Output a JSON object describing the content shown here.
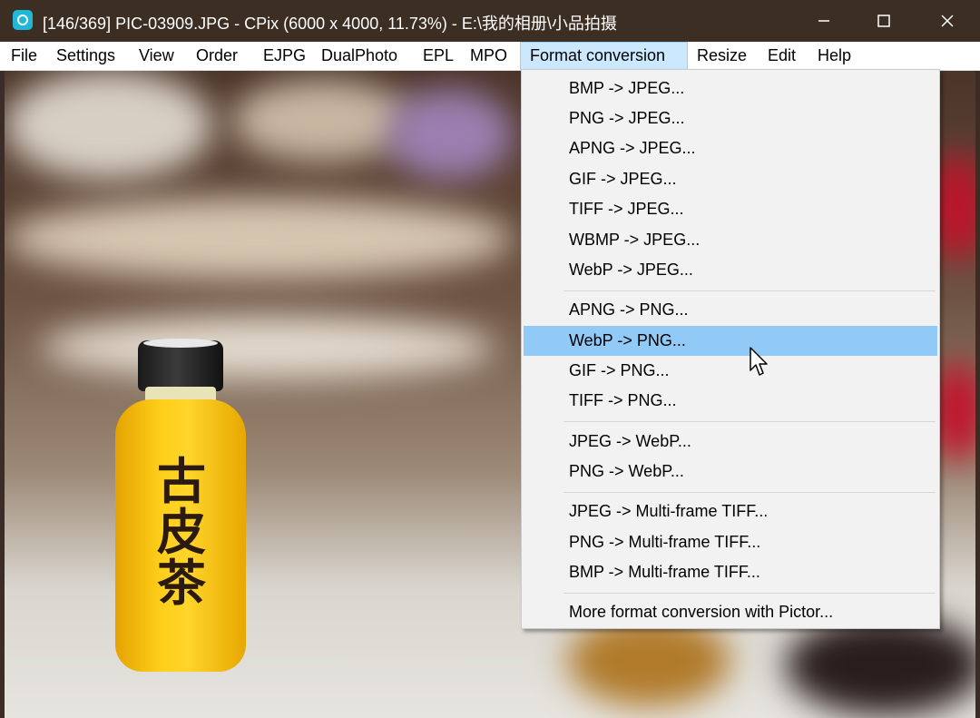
{
  "window": {
    "title": "[146/369] PIC-03909.JPG - CPix (6000 x 4000, 11.73%) - E:\\我的相册\\小品拍摄",
    "app_icon": "cpix-app-icon",
    "controls": {
      "minimize": "minimize-icon",
      "maximize": "maximize-icon",
      "close": "close-icon"
    }
  },
  "menubar": {
    "items": [
      {
        "label": "File"
      },
      {
        "label": "Settings"
      },
      {
        "label": "View"
      },
      {
        "label": "Order"
      },
      {
        "label": "EJPG"
      },
      {
        "label": "DualPhoto"
      },
      {
        "label": "EPL"
      },
      {
        "label": "MPO"
      },
      {
        "label": "Format conversion",
        "active": true
      },
      {
        "label": "Resize"
      },
      {
        "label": "Edit"
      },
      {
        "label": "Help"
      }
    ]
  },
  "photo": {
    "bottle_text": "古皮茶"
  },
  "dropdown": {
    "items": [
      {
        "label": "BMP -> JPEG..."
      },
      {
        "label": "PNG -> JPEG..."
      },
      {
        "label": "APNG -> JPEG..."
      },
      {
        "label": "GIF -> JPEG..."
      },
      {
        "label": "TIFF -> JPEG..."
      },
      {
        "label": "WBMP -> JPEG..."
      },
      {
        "label": "WebP -> JPEG..."
      },
      {
        "label": "APNG -> PNG..."
      },
      {
        "label": "WebP -> PNG...",
        "highlighted": true
      },
      {
        "label": "GIF -> PNG..."
      },
      {
        "label": "TIFF -> PNG..."
      },
      {
        "label": "JPEG -> WebP..."
      },
      {
        "label": "PNG -> WebP..."
      },
      {
        "label": "JPEG -> Multi-frame TIFF..."
      },
      {
        "label": "PNG -> Multi-frame TIFF..."
      },
      {
        "label": "BMP -> Multi-frame TIFF..."
      },
      {
        "label": "More format conversion with Pictor..."
      }
    ]
  },
  "colors": {
    "titlebar": "#3d2e24",
    "menu_active": "#cce8ff",
    "dropdown_bg": "#f2f2f2",
    "highlight": "#91c9f7"
  }
}
